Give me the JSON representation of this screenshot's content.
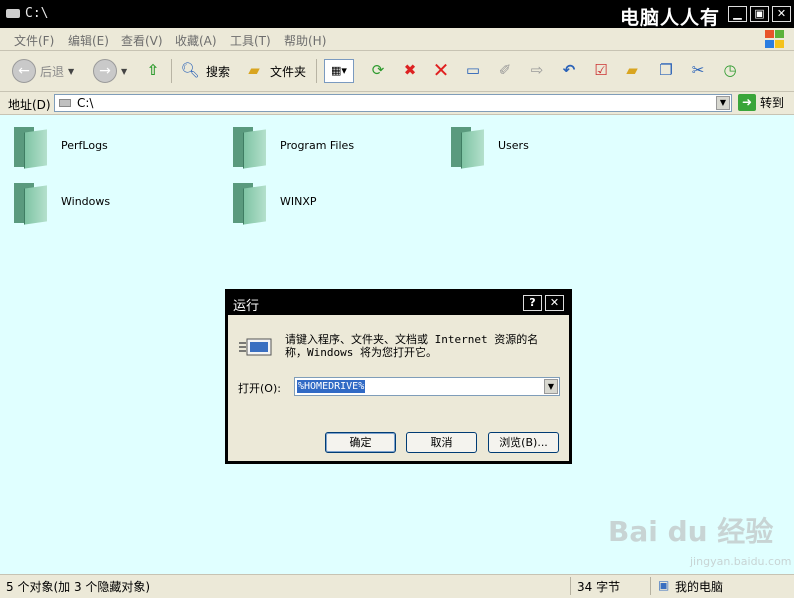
{
  "window": {
    "title": "C:\\",
    "watermark": "电脑人人有"
  },
  "menu": [
    "文件(F)",
    "编辑(E)",
    "查看(V)",
    "收藏(A)",
    "工具(T)",
    "帮助(H)"
  ],
  "toolbar": {
    "back_label": "后退",
    "search_label": "搜索",
    "folders_label": "文件夹"
  },
  "address": {
    "label": "地址(D)",
    "value": "C:\\",
    "go_label": "转到"
  },
  "folders": [
    {
      "name": "PerfLogs"
    },
    {
      "name": "Program Files"
    },
    {
      "name": "Users"
    },
    {
      "name": "Windows"
    },
    {
      "name": "WINXP"
    }
  ],
  "status": {
    "objects": "5 个对象(加 3 个隐藏对象)",
    "size": "34 字节",
    "location": "我的电脑"
  },
  "run_dialog": {
    "title": "运行",
    "help_glyph": "?",
    "close_glyph": "✕",
    "description": "请键入程序、文件夹、文档或 Internet 资源的名称，Windows 将为您打开它。",
    "open_label": "打开(O):",
    "open_value": "%HOMEDRIVE%",
    "ok_label": "确定",
    "cancel_label": "取消",
    "browse_label": "浏览(B)..."
  },
  "watermark_bottom": {
    "brand": "Bai du 经验",
    "url": "jingyan.baidu.com"
  },
  "colors": {
    "content_bg": "#e0ffff",
    "chrome_bg": "#ece9d8",
    "title_bg": "#000000",
    "selection": "#316ac5"
  }
}
